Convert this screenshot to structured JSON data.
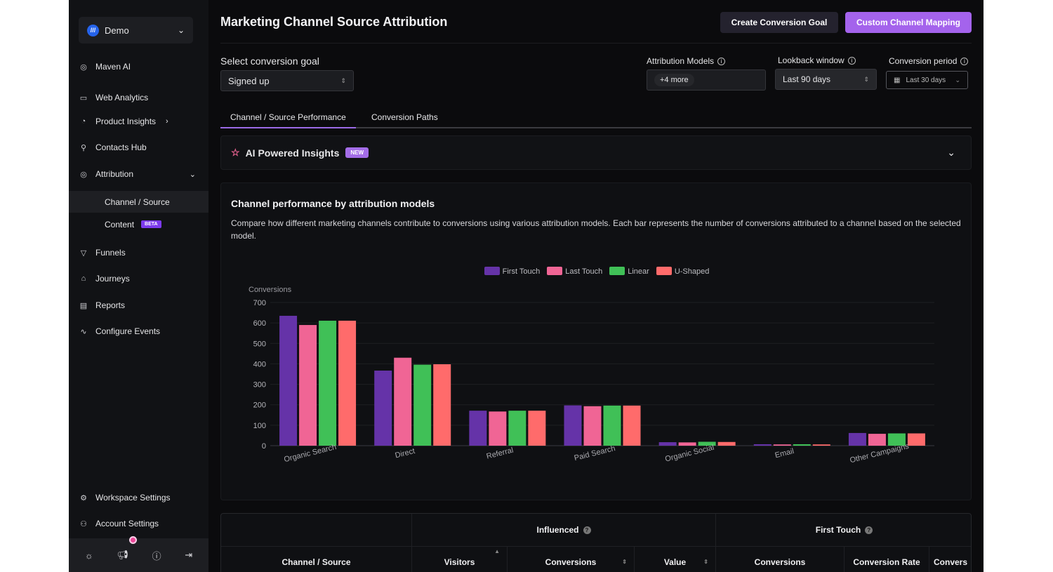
{
  "sidebar": {
    "workspace": "Demo",
    "items": [
      {
        "label": "Maven AI",
        "icon": "sparkle-circle-icon"
      },
      {
        "label": "Web Analytics",
        "icon": "browser-icon"
      },
      {
        "label": "Product Insights",
        "icon": "pie-chart-icon"
      },
      {
        "label": "Contacts Hub",
        "icon": "user-icon"
      },
      {
        "label": "Attribution",
        "icon": "target-icon"
      },
      {
        "label": "Funnels",
        "icon": "funnel-icon"
      },
      {
        "label": "Journeys",
        "icon": "journey-icon"
      },
      {
        "label": "Reports",
        "icon": "document-icon"
      },
      {
        "label": "Configure Events",
        "icon": "activity-icon"
      }
    ],
    "sub_items": [
      {
        "label": "Channel / Source"
      },
      {
        "label": "Content",
        "badge": "BETA"
      }
    ],
    "footer": [
      {
        "label": "Workspace Settings"
      },
      {
        "label": "Account Settings"
      }
    ]
  },
  "header": {
    "title": "Marketing Channel Source Attribution",
    "create_goal": "Create Conversion Goal",
    "custom_mapping": "Custom Channel Mapping"
  },
  "filters": {
    "goal_label": "Select conversion goal",
    "goal_value": "Signed up",
    "models_label": "Attribution Models",
    "models_value": "+4 more",
    "lookback_label": "Lookback window",
    "lookback_value": "Last 90 days",
    "period_label": "Conversion period",
    "period_value": "Last 30 days"
  },
  "tabs": [
    "Channel / Source Performance",
    "Conversion Paths"
  ],
  "insights": {
    "title": "AI Powered Insights",
    "badge": "NEW"
  },
  "card": {
    "title": "Channel performance by attribution models",
    "description": "Compare how different marketing channels contribute to conversions using various attribution models. Each bar represents the number of conversions attributed to a channel based on the selected model."
  },
  "chart_data": {
    "type": "bar",
    "ylabel": "Conversions",
    "ylim": [
      0,
      700
    ],
    "yticks": [
      0,
      100,
      200,
      300,
      400,
      500,
      600,
      700
    ],
    "grid": true,
    "legend_position": "top",
    "categories": [
      "Organic Search",
      "Direct",
      "Referral",
      "Paid Search",
      "Organic Social",
      "Email",
      "Other Campaigns"
    ],
    "series": [
      {
        "name": "First Touch",
        "color": "#6533a8",
        "values": [
          635,
          367,
          171,
          197,
          17,
          7,
          62
        ]
      },
      {
        "name": "Last Touch",
        "color": "#f06595",
        "values": [
          590,
          430,
          167,
          193,
          16,
          6,
          58
        ]
      },
      {
        "name": "Linear",
        "color": "#40c057",
        "values": [
          611,
          396,
          171,
          196,
          19,
          7,
          60
        ]
      },
      {
        "name": "U-Shaped",
        "color": "#ff6b6b",
        "values": [
          611,
          398,
          171,
          196,
          18,
          6,
          60
        ]
      }
    ]
  },
  "table": {
    "groups": [
      "Influenced",
      "First Touch"
    ],
    "columns": [
      "Channel / Source",
      "Visitors",
      "Conversions",
      "Value",
      "Conversions",
      "Conversion Rate",
      "Convers"
    ]
  }
}
